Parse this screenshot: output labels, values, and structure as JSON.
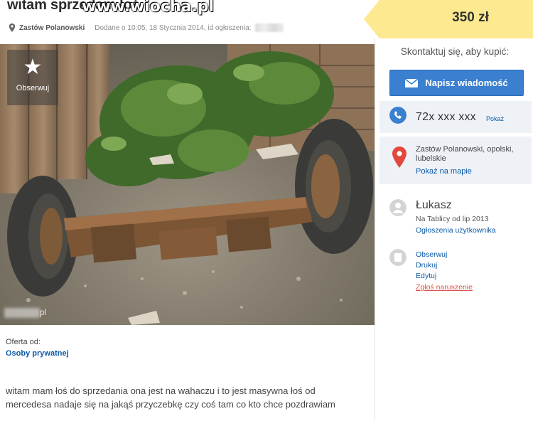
{
  "listing": {
    "title": "witam sprzedam łoś",
    "watermark": "www.wiocha.pl",
    "city": "Zastów Polanowski",
    "added": "Dodane o 10:05, 18 Stycznia 2014, id ogłoszenia:",
    "price": "350 zł"
  },
  "photo": {
    "follow_label": "Obserwuj",
    "corner_text": "pl"
  },
  "offer": {
    "from_label": "Oferta od:",
    "from_type": "Osoby prywatnej",
    "description": "witam mam łoś do sprzedania ona jest na wahaczu i to jest masywna łoś od mercedesa nadaje się na jakąś przyczebkę czy coś tam co kto chce pozdrawiam"
  },
  "sidebar": {
    "contact_heading": "Skontaktuj się, aby kupić:",
    "message_button": "Napisz wiadomość",
    "phone": "72x xxx xxx",
    "phone_show": "Pokaż",
    "location_line": "Zastów Polanowski, opolski, lubelskie",
    "map_link": "Pokaż na mapie",
    "user_name": "Łukasz",
    "user_since": "Na Tablicy od lip 2013",
    "user_ads": "Ogłoszenia użytkownika",
    "actions": {
      "follow": "Obserwuj",
      "print": "Drukuj",
      "edit": "Edytuj",
      "report": "Zgłoś naruszenie"
    }
  },
  "colors": {
    "price_tag": "#fde98f",
    "primary_button": "#3a7fd0",
    "link": "#0b59a8",
    "report": "#d9534f",
    "panel": "#eef2f7"
  },
  "icons": {
    "pin": "map-pin-icon",
    "star": "star-icon",
    "envelope": "envelope-icon",
    "phone": "phone-icon",
    "map_pin": "map-marker-icon",
    "avatar": "user-avatar-icon",
    "actions": "document-icon"
  }
}
